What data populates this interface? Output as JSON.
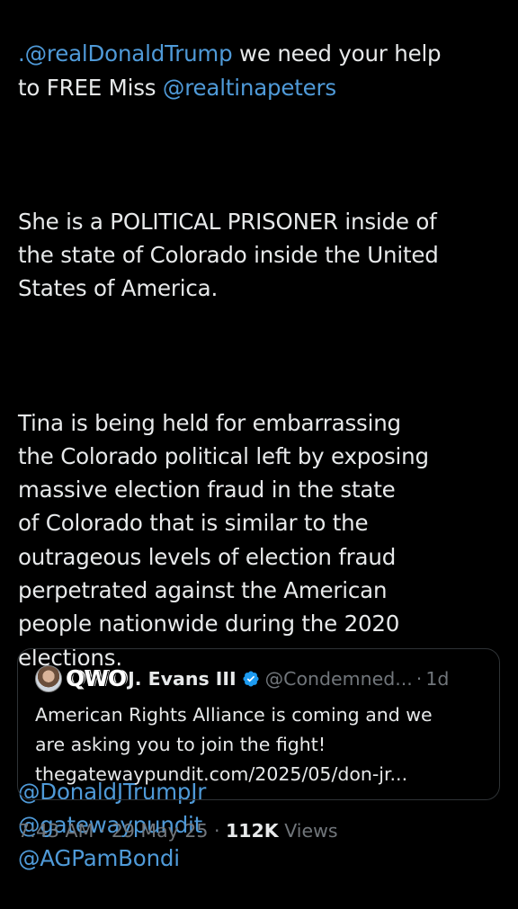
{
  "tweet": {
    "line1_mention": ".@realDonaldTrump",
    "line1_rest": " we need your help",
    "line2_text": "to FREE Miss ",
    "line2_mention": "@realtinapeters",
    "para2": "She is a POLITICAL PRISONER inside of\nthe state of Colorado inside the United\nStates of America.",
    "para3": "Tina is being held for embarrassing\nthe Colorado political left by exposing\nmassive election fraud in the state\nof Colorado that is similar to the\noutrageous levels of election fraud\nperpetrated against the American\npeople nationwide during the 2020\nelections.",
    "mentions": [
      "@DonaldJTrumpJr",
      "@gatewaypundit",
      "@AGPamBondi"
    ]
  },
  "quote": {
    "logo_text": "QWO",
    "name": "J. Evans III",
    "handle": "@Condemned...",
    "separator": "·",
    "time": "1d",
    "text_line1": "American Rights Alliance is coming and we",
    "text_line2": "are asking you to join the fight!",
    "text_line3": "thegatewaypundit.com/2025/05/don-jr..."
  },
  "meta": {
    "time": "7:43 AM",
    "separator": " · ",
    "date": "29 May 25",
    "views_count": "112K",
    "views_label": " Views"
  },
  "colors": {
    "background": "#000000",
    "text": "#e7e9ea",
    "mention": "#4f9ad8",
    "muted": "#71767b",
    "verified": "#1d9bf0",
    "border": "#2f3336"
  }
}
